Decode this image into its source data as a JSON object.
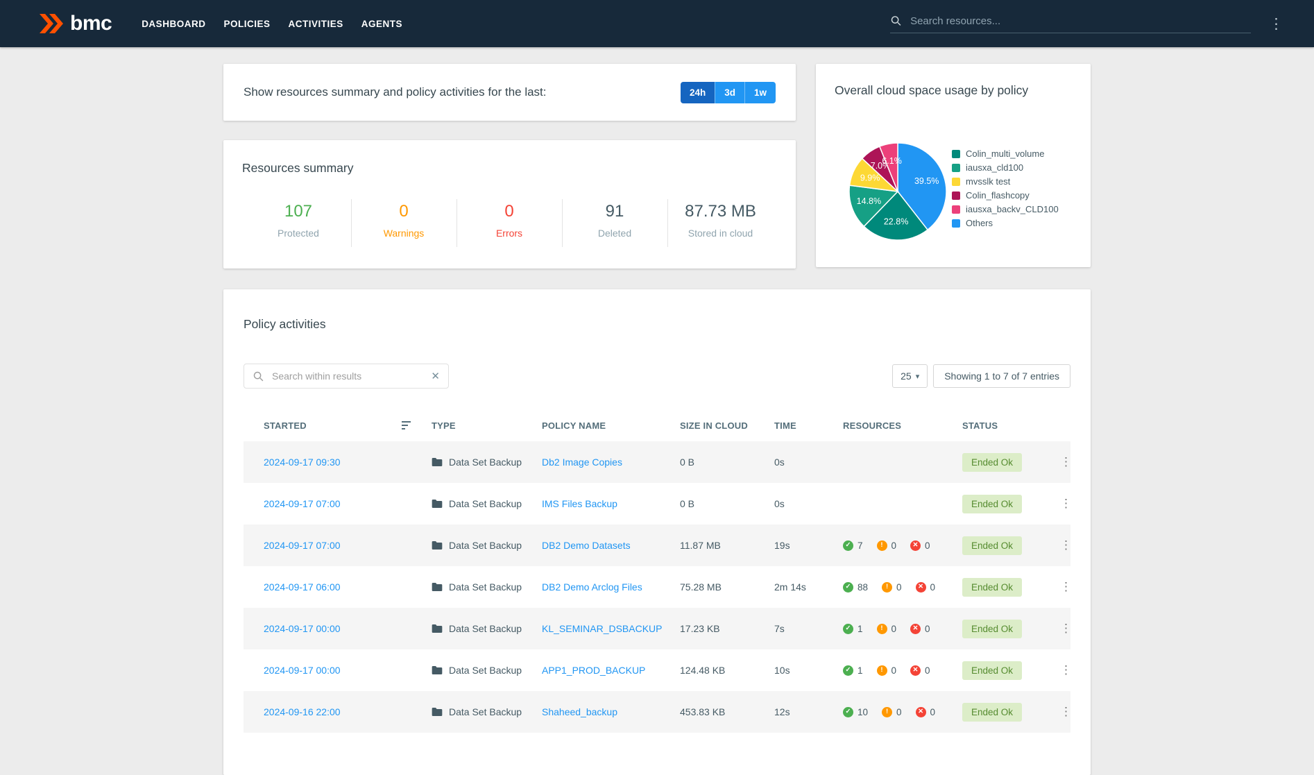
{
  "navbar": {
    "brand": "bmc",
    "items": [
      {
        "label": "DASHBOARD"
      },
      {
        "label": "POLICIES"
      },
      {
        "label": "ACTIVITIES"
      },
      {
        "label": "AGENTS"
      }
    ],
    "search_placeholder": "Search resources..."
  },
  "icons": {
    "kebab": "⋮",
    "clear": "✕",
    "caret": "▾",
    "check": "✓",
    "warning": "!",
    "error": "✕"
  },
  "time_filter": {
    "label": "Show resources summary and policy activities for the last:",
    "options": [
      "24h",
      "3d",
      "1w"
    ],
    "active": "24h"
  },
  "pie_card": {
    "title": "Overall cloud space usage by policy"
  },
  "chart_data": {
    "type": "pie",
    "title": "Overall cloud space usage by policy",
    "slices": [
      {
        "label": "Others",
        "value": 39.5,
        "color": "#2196f3"
      },
      {
        "label": "Colin_multi_volume",
        "value": 22.8,
        "color": "#00897b"
      },
      {
        "label": "iausxa_cld100",
        "value": 14.8,
        "color": "#16a085"
      },
      {
        "label": "mvsslk test",
        "value": 9.9,
        "color": "#fdd835"
      },
      {
        "label": "Colin_flashcopy",
        "value": 7.0,
        "color": "#ad1457"
      },
      {
        "label": "iausxa_backv_CLD100",
        "value": 6.1,
        "color": "#ec407a"
      }
    ],
    "legend_order": [
      "Colin_multi_volume",
      "iausxa_cld100",
      "mvsslk test",
      "Colin_flashcopy",
      "iausxa_backv_CLD100",
      "Others"
    ],
    "legend_position": "right",
    "label_format": "percent"
  },
  "resources_summary": {
    "title": "Resources summary",
    "stats": [
      {
        "value": "107",
        "label": "Protected",
        "color": "#4caf50",
        "label_color": "#90a4ae"
      },
      {
        "value": "0",
        "label": "Warnings",
        "color": "#ff9800",
        "label_color": "#ff9800"
      },
      {
        "value": "0",
        "label": "Errors",
        "color": "#f44336",
        "label_color": "#f44336"
      },
      {
        "value": "91",
        "label": "Deleted",
        "color": "#455a64",
        "label_color": "#90a4ae"
      },
      {
        "value": "87.73 MB",
        "label": "Stored in cloud",
        "color": "#455a64",
        "label_color": "#90a4ae"
      }
    ]
  },
  "policy_activities": {
    "title": "Policy activities",
    "search_placeholder": "Search within results",
    "page_size": "25",
    "showing_text": "Showing 1 to 7 of 7 entries",
    "columns": [
      "STARTED",
      "TYPE",
      "POLICY NAME",
      "SIZE IN CLOUD",
      "TIME",
      "RESOURCES",
      "STATUS"
    ],
    "rows": [
      {
        "started": "2024-09-17 09:30",
        "type": "Data Set Backup",
        "policy": "Db2 Image Copies",
        "size": "0 B",
        "time": "0s",
        "resources": null,
        "status": "Ended Ok"
      },
      {
        "started": "2024-09-17 07:00",
        "type": "Data Set Backup",
        "policy": "IMS Files Backup",
        "size": "0 B",
        "time": "0s",
        "resources": null,
        "status": "Ended Ok"
      },
      {
        "started": "2024-09-17 07:00",
        "type": "Data Set Backup",
        "policy": "DB2 Demo Datasets",
        "size": "11.87 MB",
        "time": "19s",
        "resources": {
          "ok": "7",
          "warn": "0",
          "err": "0"
        },
        "status": "Ended Ok"
      },
      {
        "started": "2024-09-17 06:00",
        "type": "Data Set Backup",
        "policy": "DB2 Demo Arclog Files",
        "size": "75.28 MB",
        "time": "2m 14s",
        "resources": {
          "ok": "88",
          "warn": "0",
          "err": "0"
        },
        "status": "Ended Ok"
      },
      {
        "started": "2024-09-17 00:00",
        "type": "Data Set Backup",
        "policy": "KL_SEMINAR_DSBACKUP",
        "size": "17.23 KB",
        "time": "7s",
        "resources": {
          "ok": "1",
          "warn": "0",
          "err": "0"
        },
        "status": "Ended Ok"
      },
      {
        "started": "2024-09-17 00:00",
        "type": "Data Set Backup",
        "policy": "APP1_PROD_BACKUP",
        "size": "124.48 KB",
        "time": "10s",
        "resources": {
          "ok": "1",
          "warn": "0",
          "err": "0"
        },
        "status": "Ended Ok"
      },
      {
        "started": "2024-09-16 22:00",
        "type": "Data Set Backup",
        "policy": "Shaheed_backup",
        "size": "453.83 KB",
        "time": "12s",
        "resources": {
          "ok": "10",
          "warn": "0",
          "err": "0"
        },
        "status": "Ended Ok"
      }
    ]
  }
}
